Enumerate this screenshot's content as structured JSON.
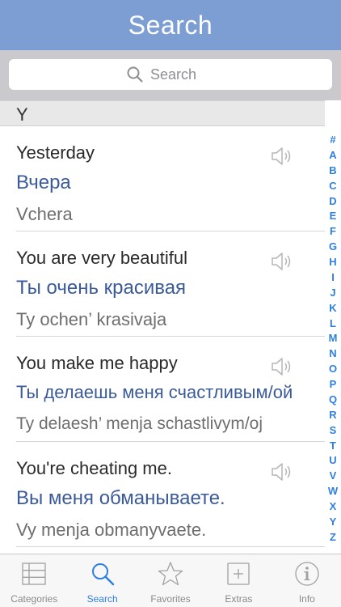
{
  "header": {
    "title": "Search"
  },
  "search": {
    "placeholder": "Search"
  },
  "section": {
    "letter": "Y"
  },
  "entries": [
    {
      "english": "Yesterday",
      "russian": "Вчера",
      "transliteration": "Vchera"
    },
    {
      "english": "You are very beautiful",
      "russian": "Ты очень красивая",
      "transliteration": "Ty ochen’ krasivaja"
    },
    {
      "english": "You make me happy",
      "russian": "Ты делаешь меня счастливым/ой",
      "transliteration": "Ty delaesh’ menja schastlivym/oj"
    },
    {
      "english": "You're cheating me.",
      "russian": "Вы меня обманываете.",
      "transliteration": "Vy menja obmanyvaete."
    }
  ],
  "index": [
    "#",
    "A",
    "B",
    "C",
    "D",
    "E",
    "F",
    "G",
    "H",
    "I",
    "J",
    "K",
    "L",
    "M",
    "N",
    "O",
    "P",
    "Q",
    "R",
    "S",
    "T",
    "U",
    "V",
    "W",
    "X",
    "Y",
    "Z"
  ],
  "tabs": [
    {
      "label": "Categories",
      "icon": "list-icon"
    },
    {
      "label": "Search",
      "icon": "search-icon"
    },
    {
      "label": "Favorites",
      "icon": "star-icon"
    },
    {
      "label": "Extras",
      "icon": "plus-box-icon"
    },
    {
      "label": "Info",
      "icon": "info-icon"
    }
  ],
  "colors": {
    "header": "#7d9ed2",
    "accent": "#2f7fe0",
    "russian_text": "#3b5a9a"
  }
}
